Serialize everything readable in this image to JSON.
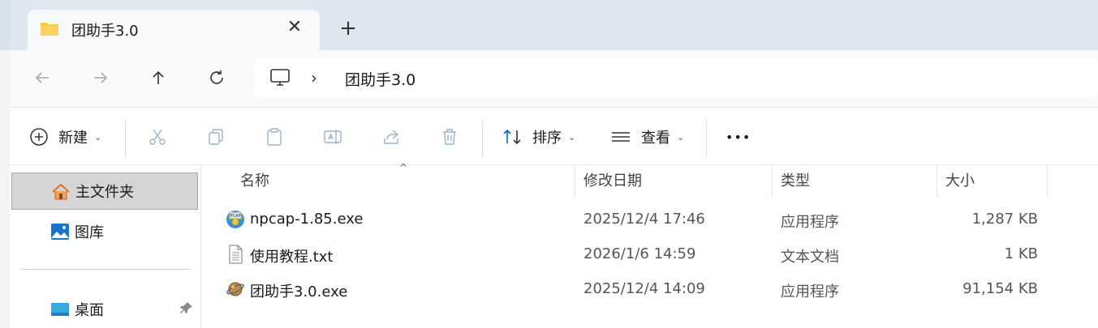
{
  "tab": {
    "title": "团助手3.0",
    "close_glyph": "✕",
    "new_tab_glyph": "+"
  },
  "nav": {
    "back_icon": "arrow-left-icon",
    "forward_icon": "arrow-right-icon",
    "up_icon": "arrow-up-icon",
    "refresh_icon": "refresh-icon",
    "address": {
      "separator": "›",
      "path": "团助手3.0"
    }
  },
  "commands": {
    "new_label": "新建",
    "sort_label": "排序",
    "view_label": "查看",
    "more_glyph": "•••"
  },
  "sidebar": {
    "items": [
      {
        "label": "主文件夹",
        "icon": "home-icon",
        "selected": true
      },
      {
        "label": "图库",
        "icon": "gallery-icon",
        "selected": false
      },
      {
        "label": "桌面",
        "icon": "desktop-icon",
        "selected": false
      }
    ],
    "pin_glyph": "📌"
  },
  "columns": {
    "name": "名称",
    "modified": "修改日期",
    "type": "类型",
    "size": "大小",
    "sort_glyph": "^"
  },
  "files": [
    {
      "name": "npcap-1.85.exe",
      "modified": "2025/12/4 17:46",
      "type": "应用程序",
      "size": "1,287 KB",
      "icon": "installer-icon"
    },
    {
      "name": "使用教程.txt",
      "modified": "2026/1/6 14:59",
      "type": "文本文档",
      "size": "1 KB",
      "icon": "text-file-icon"
    },
    {
      "name": "团助手3.0.exe",
      "modified": "2025/12/4 14:09",
      "type": "应用程序",
      "size": "91,154 KB",
      "icon": "app-icon"
    }
  ],
  "colors": {
    "accent": "#0067c0",
    "folder": "#f8c94a",
    "selected_bg": "#d5d5d5"
  }
}
